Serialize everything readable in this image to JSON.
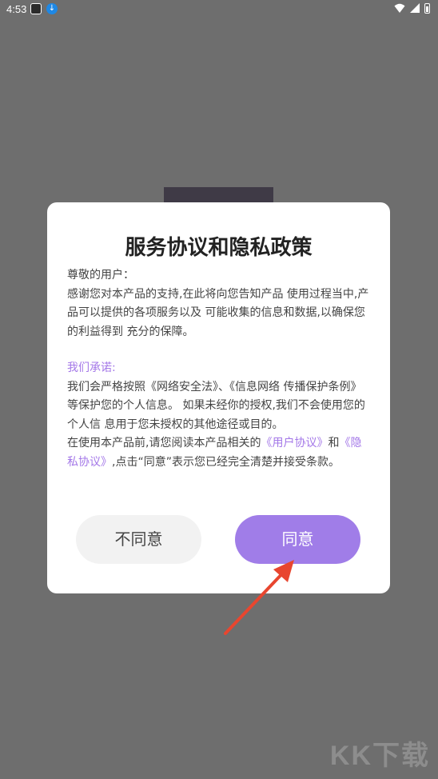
{
  "status_bar": {
    "time": "4:53",
    "icons": [
      "app-icon",
      "download-icon",
      "wifi-icon",
      "signal-icon",
      "battery-icon"
    ]
  },
  "dialog": {
    "title": "服务协议和隐私政策",
    "greeting": "尊敬的用户：",
    "intro": " 感谢您对本产品的支持,在此将向您告知产品 使用过程当中,产品可以提供的各项服务以及 可能收集的信息和数据,以确保您的利益得到 充分的保障。",
    "promise_heading": "我们承诺:",
    "promise_text": "我们会严格按照《网络安全法》、《信息网络 传播保护条例》等保护您的个人信息。 如果未经你的授权,我们不会使用您的个人信 息用于您未授权的其他途径或目的。",
    "usage_prefix": "在使用本产品前,请您阅读本产品相关的",
    "user_agreement_link": "《用户协议》",
    "and_text": "和",
    "privacy_agreement_link": "《隐私协议》",
    "usage_suffix": ",点击“同意”表示您已经完全清楚并接受条款。",
    "disagree_label": "不同意",
    "agree_label": "同意"
  },
  "watermark": "KK下载",
  "colors": {
    "accent": "#a07de8",
    "link": "#a478e8",
    "overlay": "#6e6e6e",
    "arrow": "#e8462f"
  }
}
